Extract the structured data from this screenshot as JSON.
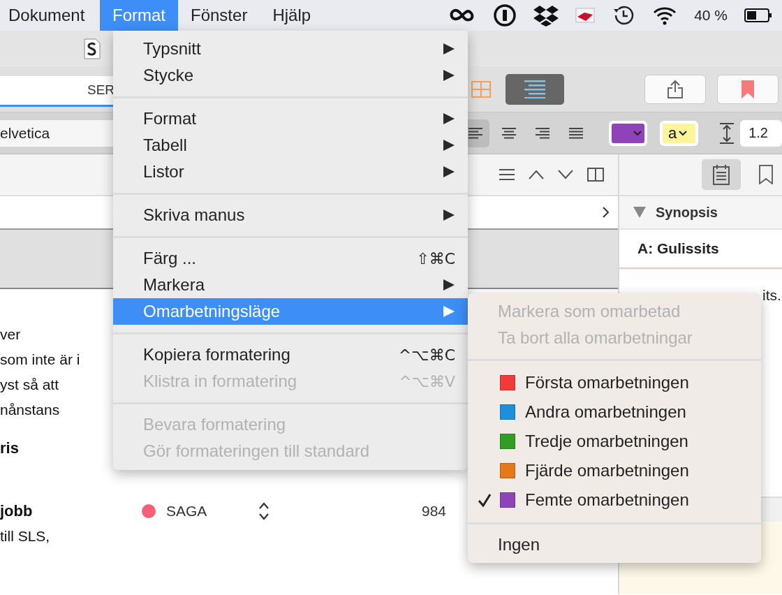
{
  "menubar": {
    "items": [
      {
        "label": "Dokument",
        "selected": false
      },
      {
        "label": "Format",
        "selected": true
      },
      {
        "label": "Fönster",
        "selected": false
      },
      {
        "label": "Hjälp",
        "selected": false
      }
    ],
    "battery_text": "40 %"
  },
  "toolbar": {
    "tabs": [
      {
        "label": "SER",
        "selected": true
      }
    ],
    "view_buttons": [
      {
        "kind": "grid",
        "selected": false
      },
      {
        "kind": "outline",
        "selected": true
      }
    ]
  },
  "format_bar": {
    "font_field": "elvetica",
    "alignments": [
      {
        "kind": "left",
        "selected": true
      },
      {
        "kind": "center",
        "selected": false
      },
      {
        "kind": "right",
        "selected": false
      },
      {
        "kind": "justify",
        "selected": false
      }
    ],
    "color_wells": [
      {
        "kind": "text",
        "color": "#8e44b8"
      },
      {
        "kind": "highlight",
        "color": "#fdf59a",
        "label": "a"
      }
    ],
    "line_spacing": "1.2"
  },
  "editor": {
    "lines": [
      {
        "text": "ver",
        "bold": false
      },
      {
        "text": "som inte är i",
        "bold": false
      },
      {
        "text": "yst så att",
        "bold": false
      },
      {
        "text": "nånstans",
        "bold": false
      },
      {
        "text": "ris",
        "bold": true
      }
    ],
    "row": {
      "title": "jobb",
      "label": "SAGA",
      "color": "#f4607a",
      "count": "984"
    },
    "last_line": "till SLS,"
  },
  "inspector": {
    "section": "Synopsis",
    "expanded": true,
    "title": "A: Gulissits",
    "text_fragment": "its."
  },
  "menu": {
    "groups": [
      [
        {
          "label": "Typsnitt",
          "disabled": false,
          "selected": false,
          "has_submenu": true
        },
        {
          "label": "Stycke",
          "disabled": false,
          "selected": false,
          "has_submenu": true
        }
      ],
      [
        {
          "label": "Format",
          "disabled": false,
          "selected": false,
          "has_submenu": true
        },
        {
          "label": "Tabell",
          "disabled": false,
          "selected": false,
          "has_submenu": true
        },
        {
          "label": "Listor",
          "disabled": false,
          "selected": false,
          "has_submenu": true
        }
      ],
      [
        {
          "label": "Skriva manus",
          "disabled": false,
          "selected": false,
          "has_submenu": true
        }
      ],
      [
        {
          "label": "Färg ...",
          "disabled": false,
          "selected": false,
          "has_submenu": false,
          "shortcut": "⇧⌘C"
        },
        {
          "label": "Markera",
          "disabled": false,
          "selected": false,
          "has_submenu": true
        },
        {
          "label": "Omarbetningsläge",
          "disabled": false,
          "selected": true,
          "has_submenu": true
        }
      ],
      [
        {
          "label": "Kopiera formatering",
          "disabled": false,
          "selected": false,
          "has_submenu": false,
          "shortcut": "^⌥⌘C"
        },
        {
          "label": "Klistra in formatering",
          "disabled": true,
          "selected": false,
          "has_submenu": false,
          "shortcut": "^⌥⌘V"
        }
      ],
      [
        {
          "label": "Bevara formatering",
          "disabled": true,
          "selected": false,
          "has_submenu": false
        },
        {
          "label": "Gör formateringen till standard",
          "disabled": true,
          "selected": false,
          "has_submenu": false
        }
      ]
    ]
  },
  "submenu": {
    "groups": [
      [
        {
          "kind": "plain",
          "label": "Markera som omarbetad",
          "disabled": true,
          "checked": false
        },
        {
          "kind": "plain",
          "label": "Ta bort alla omarbetningar",
          "disabled": true,
          "checked": false
        }
      ],
      [
        {
          "kind": "swatch",
          "label": "Första omarbetningen",
          "disabled": false,
          "checked": false,
          "color": "#f23a3a"
        },
        {
          "kind": "swatch",
          "label": "Andra omarbetningen",
          "disabled": false,
          "checked": false,
          "color": "#1e8fdc"
        },
        {
          "kind": "swatch",
          "label": "Tredje omarbetningen",
          "disabled": false,
          "checked": false,
          "color": "#2f9e22"
        },
        {
          "kind": "swatch",
          "label": "Fjärde omarbetningen",
          "disabled": false,
          "checked": false,
          "color": "#e27a1c"
        },
        {
          "kind": "swatch",
          "label": "Femte omarbetningen",
          "disabled": false,
          "checked": true,
          "color": "#8e44b8"
        }
      ],
      [
        {
          "kind": "plain",
          "label": "Ingen",
          "disabled": false,
          "checked": false
        }
      ]
    ]
  }
}
